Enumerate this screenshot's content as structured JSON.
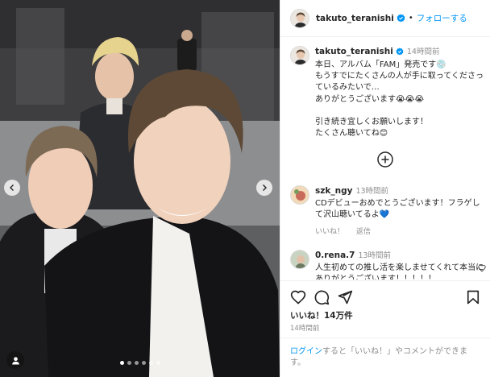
{
  "post": {
    "username": "takuto_teranishi",
    "follow_label": "フォローする",
    "separator": "•",
    "caption_time": "14時間前",
    "caption": "本日、アルバム「FAM」発売です💿\nもうすでにたくさんの人が手に取ってくださっているみたいで…\nありがとうございます😭😭😭\n\n引き続き宜しくお願いします！\nたくさん聴いてね😊",
    "likes_label": "いいね！14万件",
    "posted": "14時間前"
  },
  "comments": [
    {
      "username": "szk_ngy",
      "time": "13時間前",
      "text": "CDデビューおめでとうございます！フラゲして沢山聴いてるよ💙",
      "like_label": "いいね！",
      "reply_label": "返信"
    },
    {
      "username": "0.rena.7",
      "time": "13時間前",
      "text": "人生初めての推し活を楽しませてくれて本当にありがとうございます！！！！！"
    }
  ],
  "login": {
    "link_label": "ログイン",
    "rest_label": "すると「いいね！」やコメントができます。"
  },
  "carousel": {
    "slides": 6,
    "active_index": 0
  },
  "icons": {
    "verified": "verified-badge-icon",
    "heart": "heart-icon",
    "comment": "comment-icon",
    "share": "share-icon",
    "save": "bookmark-icon",
    "plus": "plus-circle-icon",
    "tag": "user-tag-icon",
    "prev": "chevron-left-icon",
    "next": "chevron-right-icon"
  },
  "colors": {
    "link": "#0095f6",
    "verified": "#0095f6",
    "muted": "#8e8e8e",
    "text": "#262626"
  }
}
